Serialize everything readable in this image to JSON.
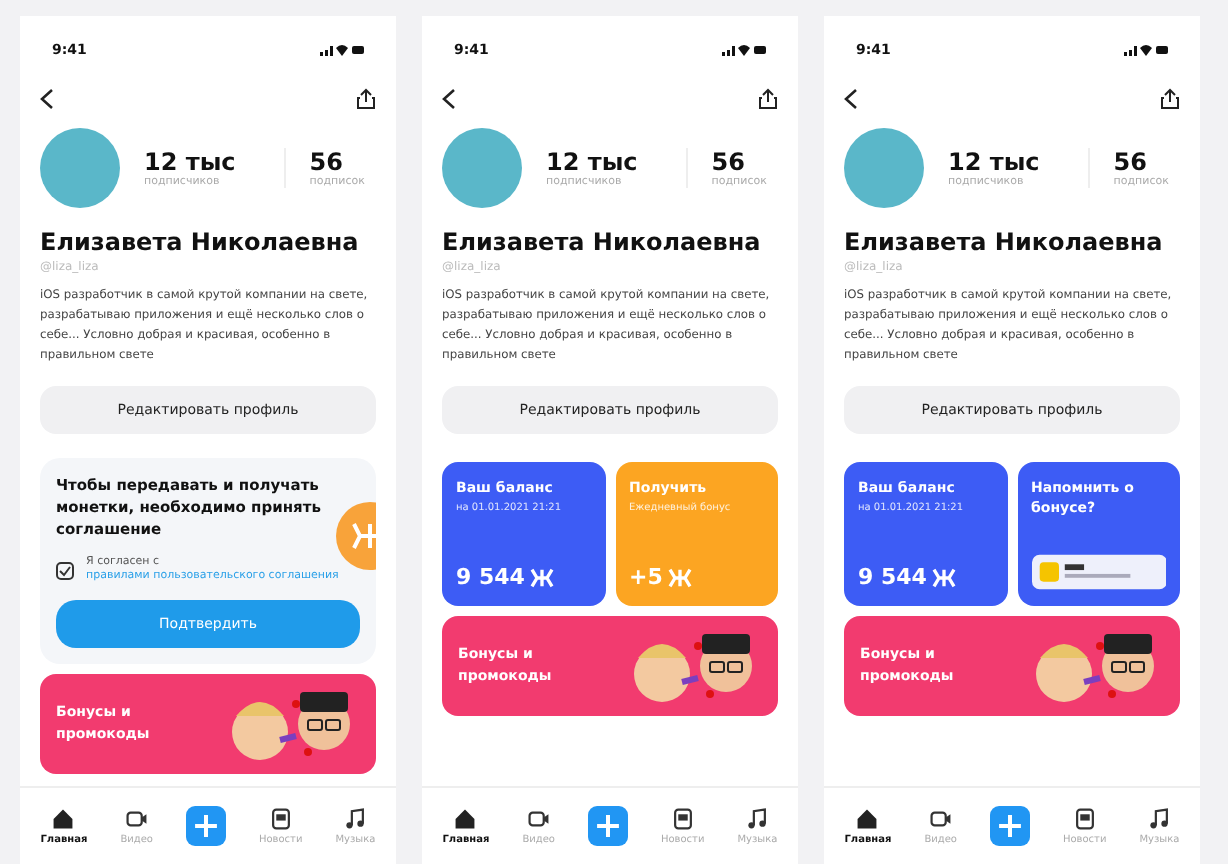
{
  "screens": [
    {
      "time": "9:41",
      "stats": [
        {
          "value": "12 тыс",
          "label": "подписчиков"
        },
        {
          "value": "56",
          "label": "подписок"
        }
      ],
      "name": "Елизавета Николаевна",
      "handle": "@liza_liza",
      "bio": "iOS разработчик в самой крутой компании на свете, разрабатываю приложения и ещё несколько слов о себе... Условно добрая и красивая, особенно в правильном свете",
      "edit_button": "Редактировать профиль",
      "section": {
        "kind": "agreement",
        "text": "Чтобы передавать и получать монетки, необходимо принять соглашение",
        "checked": true,
        "consent": "Я согласен с ",
        "consent_link": "правилами пользовательского соглашения",
        "button": "Подтвердить"
      },
      "banner": "Бонусы и промокоды",
      "tabs": [
        {
          "label": "Главная",
          "selected": true
        },
        {
          "label": "Видео",
          "selected": false
        },
        {
          "label": "Новости",
          "selected": false
        },
        {
          "label": "Музыка",
          "selected": false
        }
      ]
    },
    {
      "time": "9:41",
      "stats": [
        {
          "value": "12 тыс",
          "label": "подписчиков"
        },
        {
          "value": "56",
          "label": "подписок"
        }
      ],
      "name": "Елизавета Николаевна",
      "handle": "@liza_liza",
      "bio": "iOS разработчик в самой крутой компании на свете, разрабатываю приложения и ещё несколько слов о себе... Условно добрая и красивая, особенно в правильном свете",
      "edit_button": "Редактировать профиль",
      "section": {
        "kind": "cards",
        "cards": [
          {
            "kind": "balance",
            "title": "Ваш баланс",
            "subtitle": "на 01.01.2021 21:21",
            "amount": "9 544"
          },
          {
            "kind": "bonus",
            "title": "Получить",
            "subtitle": "Ежедневный бонус",
            "amount": "+5"
          }
        ]
      },
      "banner": "Бонусы и промокоды",
      "tabs": [
        {
          "label": "Главная",
          "selected": true
        },
        {
          "label": "Видео",
          "selected": false
        },
        {
          "label": "Новости",
          "selected": false
        },
        {
          "label": "Музыка",
          "selected": false
        }
      ]
    },
    {
      "time": "9:41",
      "stats": [
        {
          "value": "12 тыс",
          "label": "подписчиков"
        },
        {
          "value": "56",
          "label": "подписок"
        }
      ],
      "name": "Елизавета Николаевна",
      "handle": "@liza_liza",
      "bio": "iOS разработчик в самой крутой компании на свете, разрабатываю приложения и ещё несколько слов о себе... Условно добрая и красивая, особенно в правильном свете",
      "edit_button": "Редактировать профиль",
      "section": {
        "kind": "cards",
        "cards": [
          {
            "kind": "balance",
            "title": "Ваш баланс",
            "subtitle": "на 01.01.2021 21:21",
            "amount": "9 544"
          },
          {
            "kind": "reminder",
            "title": "Напомнить о бонусе?"
          }
        ]
      },
      "banner": "Бонусы и промокоды",
      "tabs": [
        {
          "label": "Главная",
          "selected": true
        },
        {
          "label": "Видео",
          "selected": false
        },
        {
          "label": "Новости",
          "selected": false
        },
        {
          "label": "Музыка",
          "selected": false
        }
      ]
    }
  ]
}
